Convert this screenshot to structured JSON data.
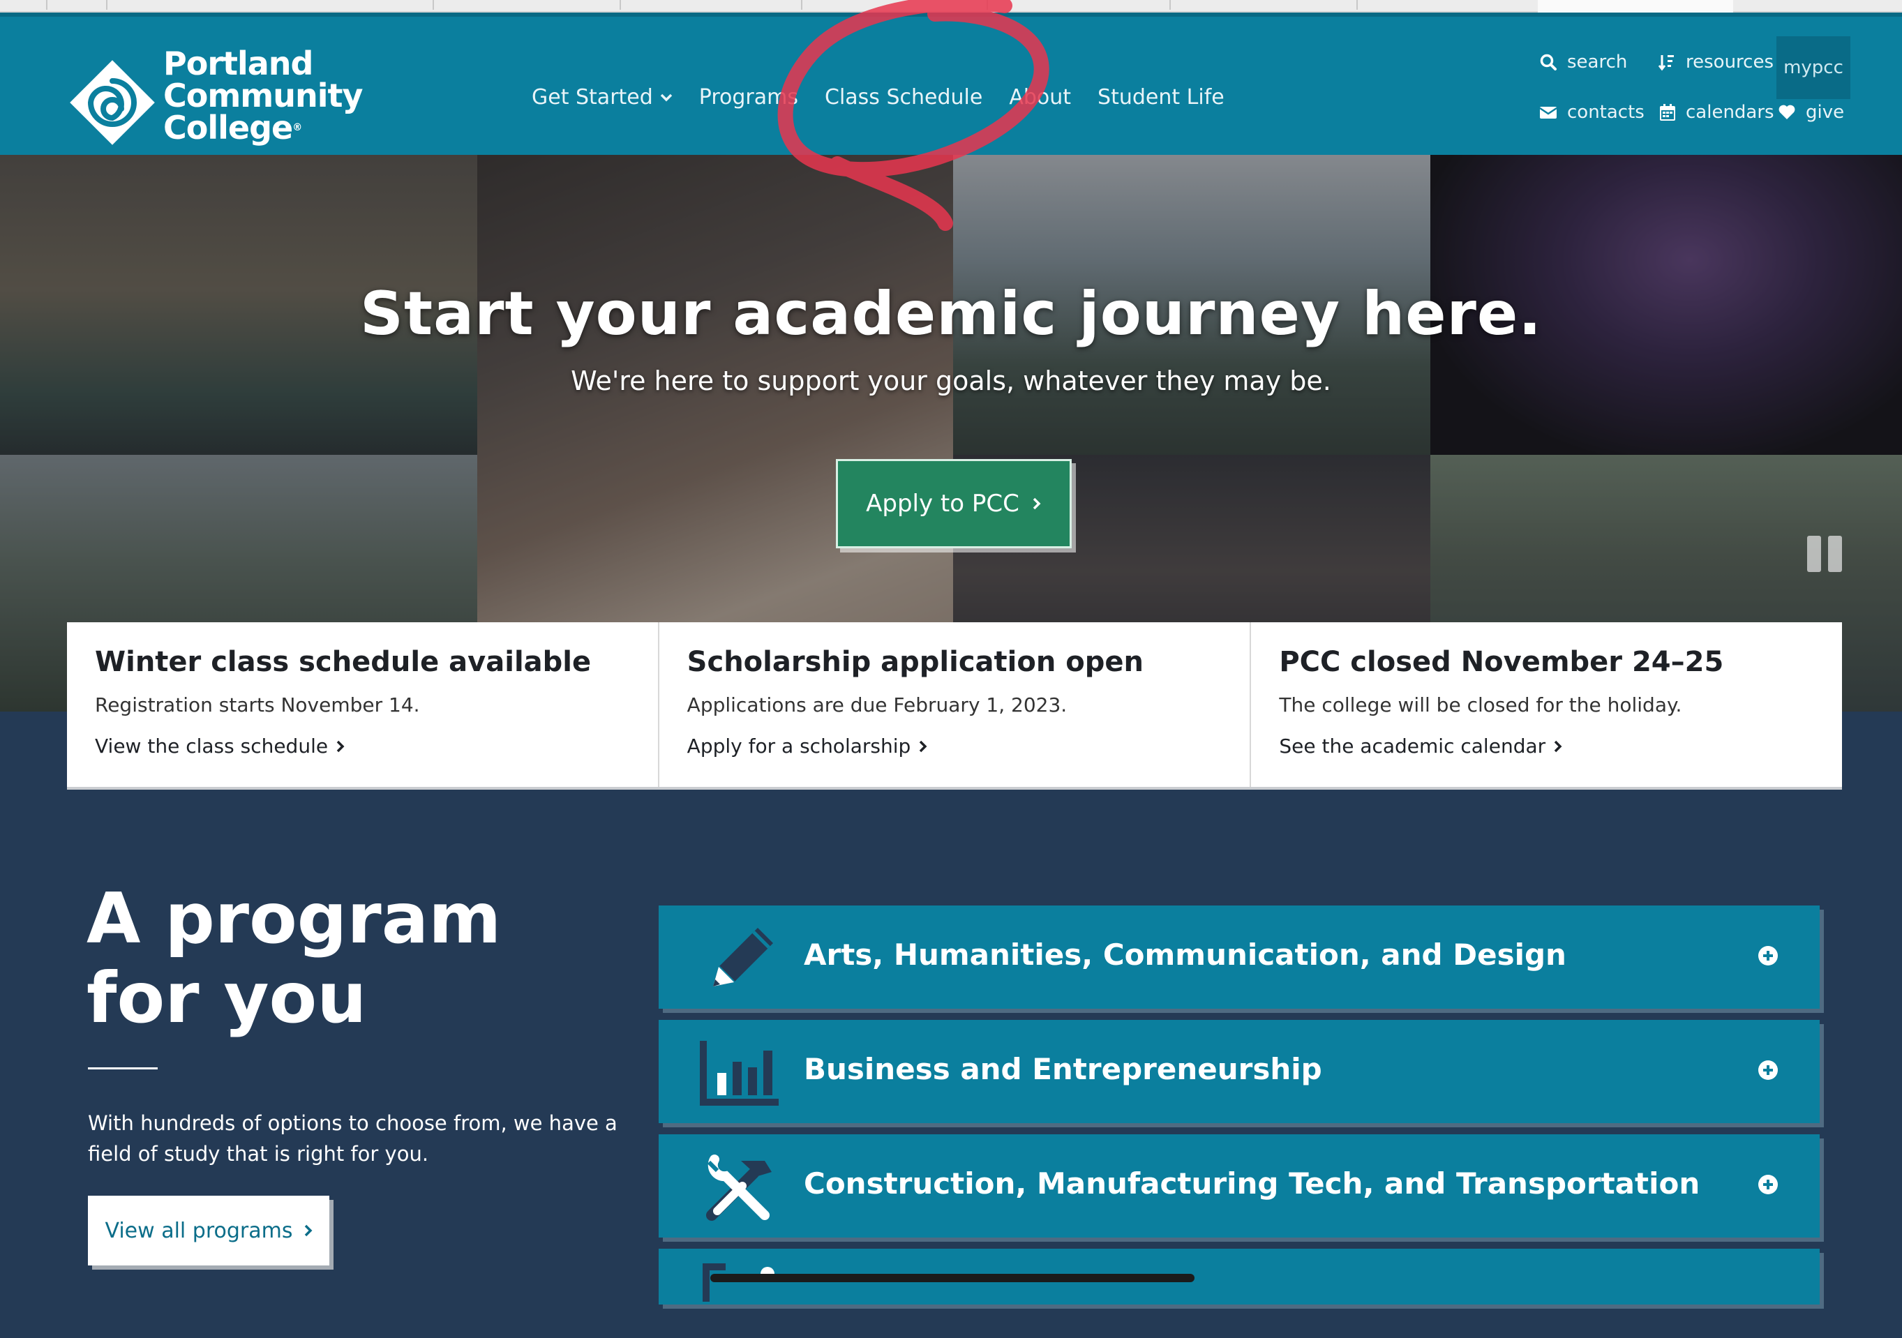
{
  "header": {
    "logo": {
      "line1": "Portland",
      "line2": "Community",
      "line3": "College",
      "reg": "®"
    },
    "main_nav": [
      {
        "label": "Get Started",
        "has_dropdown": true
      },
      {
        "label": "Programs"
      },
      {
        "label": "Class Schedule"
      },
      {
        "label": "About"
      },
      {
        "label": "Student Life"
      }
    ],
    "utility_nav": {
      "search": "search",
      "resources": "resources",
      "mypcc": "mypcc",
      "contacts": "contacts",
      "calendars": "calendars",
      "give": "give"
    }
  },
  "hero": {
    "title": "Start your academic journey here.",
    "subtitle": "We're here to support your goals, whatever they may be.",
    "apply_label": "Apply to PCC"
  },
  "announcements": [
    {
      "title": "Winter class schedule available",
      "text": "Registration starts November 14.",
      "link": "View the class schedule"
    },
    {
      "title": "Scholarship application open",
      "text": "Applications are due February 1, 2023.",
      "link": "Apply for a scholarship"
    },
    {
      "title": "PCC closed November 24–25",
      "text": "The college will be closed for the holiday.",
      "link": "See the academic calendar"
    }
  ],
  "programs": {
    "heading_line1": "A program",
    "heading_line2": "for you",
    "description": "With hundreds of options to choose from, we have a field of study that is right for you.",
    "button_label": "View all programs",
    "areas": [
      {
        "label": "Arts, Humanities, Communication, and Design",
        "icon": "pencil-icon"
      },
      {
        "label": "Business and Entrepreneurship",
        "icon": "bar-chart-icon"
      },
      {
        "label": "Construction, Manufacturing Tech, and Transportation",
        "icon": "tools-icon"
      }
    ]
  },
  "colors": {
    "header_teal": "#0b7f9e",
    "page_navy": "#243a55",
    "apply_green": "#23855f",
    "annotation_red": "#e8364f"
  }
}
